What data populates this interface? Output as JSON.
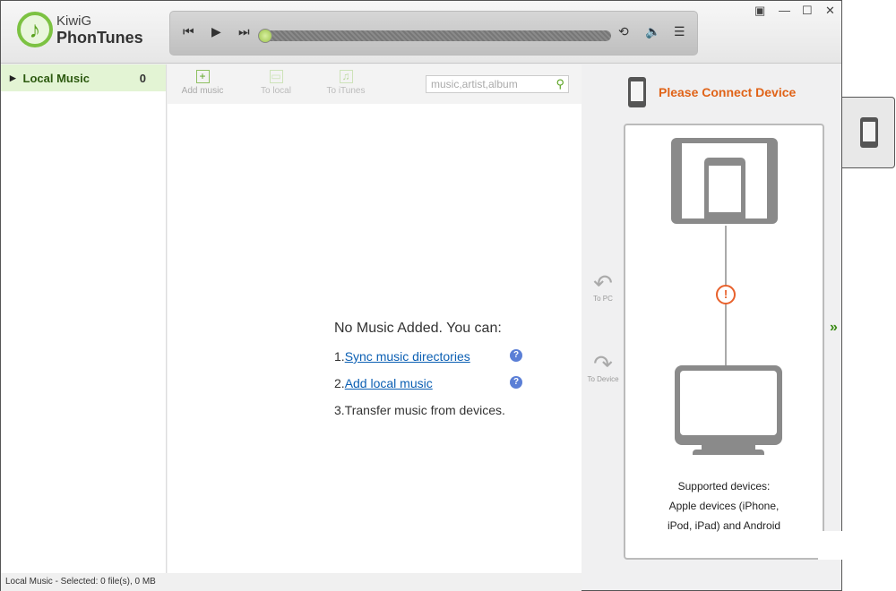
{
  "app": {
    "brand_top": "KiwiG",
    "brand_name": "PhonTunes"
  },
  "window_controls": {
    "menu": "▣",
    "minimize": "—",
    "maximize": "☐",
    "close": "✕"
  },
  "player": {
    "prev": "⏮",
    "play": "▶",
    "next": "⏭",
    "repeat": "⟲",
    "volume": "🔈",
    "playlist": "☰",
    "progress": 0
  },
  "sidebar": {
    "items": [
      {
        "label": "Local Music",
        "count": "0",
        "arrow": "▸"
      }
    ]
  },
  "toolbar": {
    "add_music": "Add music",
    "to_local": "To local",
    "to_itunes": "To iTunes",
    "search_placeholder": "music,artist,album"
  },
  "empty": {
    "title": "No Music Added. You can:",
    "step1_num": "1.",
    "step1_link": "Sync music directories",
    "step2_num": "2.",
    "step2_link": "Add local music",
    "step3": "3.Transfer music from devices.",
    "help": "?"
  },
  "transfer": {
    "to_pc": "To PC",
    "to_device": "To Device"
  },
  "device": {
    "title": "Please Connect Device",
    "warn": "!",
    "supported_1": "Supported devices:",
    "supported_2": "Apple devices (iPhone,",
    "supported_3": "iPod, iPad) and Android",
    "expand": "»"
  },
  "status": {
    "text": "Local Music - Selected: 0 file(s), 0 MB"
  }
}
